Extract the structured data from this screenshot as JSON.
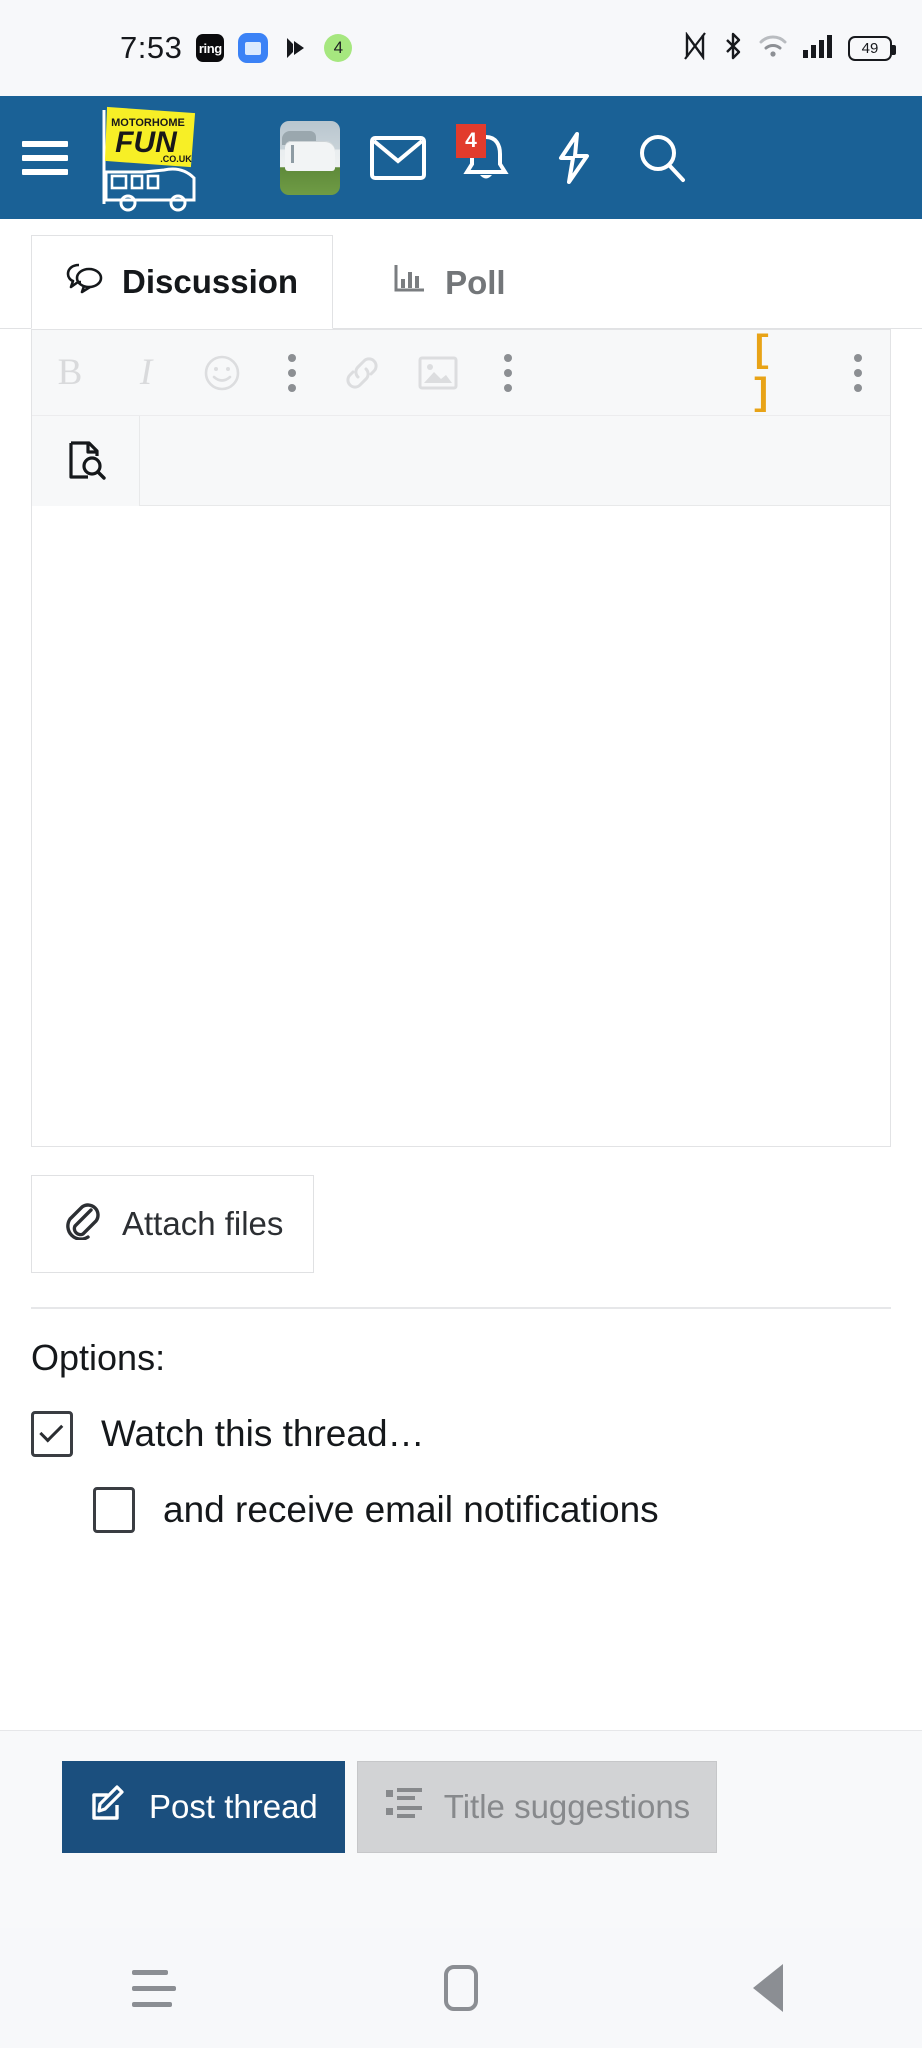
{
  "status_bar": {
    "time": "7:53",
    "left_icons": [
      {
        "name": "ring-app-icon",
        "label": "ring"
      },
      {
        "name": "message-app-icon",
        "label": ""
      },
      {
        "name": "play-app-icon",
        "label": ""
      },
      {
        "name": "notification-count-icon",
        "label": "4"
      }
    ],
    "right_icons": [
      {
        "name": "nfc-icon"
      },
      {
        "name": "bluetooth-icon"
      },
      {
        "name": "wifi-icon"
      },
      {
        "name": "cellular-signal-icon"
      }
    ],
    "battery_level": "49"
  },
  "app_header": {
    "menu_label": "menu",
    "logo": {
      "line1": "MOTORHOME",
      "line2": "FUN",
      "line3": ".CO.UK"
    },
    "avatar_alt": "motorhome avatar",
    "icons": [
      {
        "name": "avatar",
        "label": ""
      },
      {
        "name": "inbox-icon",
        "label": ""
      },
      {
        "name": "alerts-bell-icon",
        "label": "",
        "badge": "4"
      },
      {
        "name": "quick-actions-bolt-icon",
        "label": ""
      },
      {
        "name": "search-icon",
        "label": ""
      }
    ],
    "alerts_badge": "4",
    "brand_color": "#1a6196"
  },
  "tabs": [
    {
      "label": "Discussion",
      "icon": "discussion-bubbles-icon",
      "active": true
    },
    {
      "label": "Poll",
      "icon": "poll-chart-icon",
      "active": false
    }
  ],
  "editor": {
    "toolbar_primary": [
      {
        "name": "bold-button",
        "label": "B"
      },
      {
        "name": "italic-button",
        "label": "I"
      },
      {
        "name": "smilies-button",
        "label": ""
      },
      {
        "name": "text-more-options-button",
        "label": ""
      },
      {
        "name": "insert-link-button",
        "label": ""
      },
      {
        "name": "insert-image-button",
        "label": ""
      },
      {
        "name": "insert-more-options-button",
        "label": ""
      },
      {
        "name": "toggle-bb-code-button",
        "label": "[ ]"
      },
      {
        "name": "editor-more-options-button",
        "label": ""
      }
    ],
    "toolbar_secondary": [
      {
        "name": "preview-document-button",
        "label": ""
      }
    ],
    "body_value": "",
    "body_placeholder": "",
    "bb_code_color": "#e8a317"
  },
  "attach": {
    "label": "Attach files",
    "icon": "paperclip-icon"
  },
  "options": {
    "title": "Options:",
    "items": [
      {
        "label": "Watch this thread…",
        "checked": true,
        "indent": false
      },
      {
        "label": "and receive email notifications",
        "checked": false,
        "indent": true
      }
    ]
  },
  "action_bar": {
    "primary": {
      "label": "Post thread",
      "icon": "compose-pencil-icon",
      "color": "#1b4f7e"
    },
    "secondary": {
      "label": "Title suggestions",
      "icon": "list-icon",
      "color": "#d2d3d5"
    }
  },
  "nav_bar": {
    "items": [
      {
        "name": "recents-button",
        "label": ""
      },
      {
        "name": "home-button",
        "label": ""
      },
      {
        "name": "back-button",
        "label": ""
      }
    ]
  }
}
